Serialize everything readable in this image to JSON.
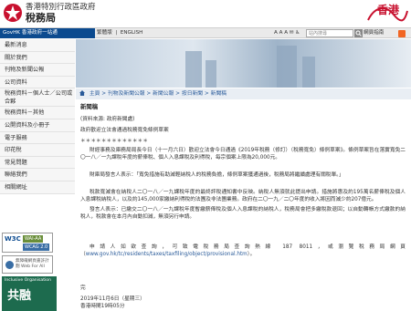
{
  "header": {
    "gov_name": "香港特別行政區政府",
    "dept_name": "稅務局",
    "brand_text": "香港"
  },
  "topbar": {
    "govhk": "GovHK 香港政府一站通",
    "lang_tc": "繁體版",
    "lang_en": "ENGLISH",
    "util": "A A A  ✉  ♿",
    "search_placeholder": "站內搜尋",
    "sitemap": "網頁指南"
  },
  "nav": {
    "items": [
      "最新消息",
      "關於我們",
      "刊物及新聞公報",
      "公司資料",
      "稅務資料－個人士／公司或合夥",
      "稅務資料－其他",
      "公開資料及小冊子",
      "電子服務",
      "印花稅",
      "常見問題",
      "聯絡我們",
      "相關網址"
    ]
  },
  "badges": {
    "wcag_w3c": "W3C",
    "wcag_aa": "WAI-AA",
    "wcag_ver": "WCAG 2.0",
    "web_text": "無障礙網頁嘉許計劃 Web For All",
    "incl_top": "Inclusive Organisation",
    "incl_big": "共融"
  },
  "breadcrumb": {
    "home": "主頁",
    "c1": "刊物及新聞公報",
    "c2": "新聞公報",
    "c3": "按日新聞",
    "c4": "新聞稿"
  },
  "content": {
    "title": "新聞稿",
    "source": "(資料來源: 政府新聞處)",
    "heading": "政府歡迎立法會通過稅務寬免條例草案",
    "sub": "＊＊＊＊＊＊＊＊＊＊＊＊＊",
    "p1": "財經事務及庫務局局長今日（十一月六日）歡迎立法會今日通過《2019年稅務（修訂）（稅務寬免）條例草案》。條例草案旨在落實寬免二〇一八／一九課稅年度的薪俸稅、個人入息課稅及利得稅，每宗個案上限為20,000元。",
    "p2": "財庫局發言人表示：「寬免措施有助減輕納稅人的稅務負擔，條例草案獲通過後，稅務局將繼續處理有關稅單。」",
    "p3": "稅款寬減會在納稅人二〇一八／一九課稅年度的最終評稅通知書中反映。納稅人無須就此提出申請。措施將惠及約195萬名薪俸稅及個人入息課稅納稅人，以及約145,000家繳納利得稅的法團及非法團業務。政府在二〇一九／二〇年度的收入將因而減少約207億元。",
    "p4": "發言人表示：已繳交二〇一八／一九課稅年度暫繳薪俸稅及個人入息課稅的納稅人，稅務局會把多繳稅款退回；以自動轉帳方式繳款的納稅人，稅款會在本月內自動扣減，無須另行申請。",
    "p5": "申請人如欲查詢，可致電稅務局查詢熱線 187 8011，或瀏覽稅務局網頁（",
    "p5_link": "www.gov.hk/tc/residents/taxes/taxfiling/object/provisional.htm",
    "p5_tail": "）。",
    "end": "完",
    "date": "2019年11月6日（星期三）",
    "time": "香港時間19時05分"
  }
}
